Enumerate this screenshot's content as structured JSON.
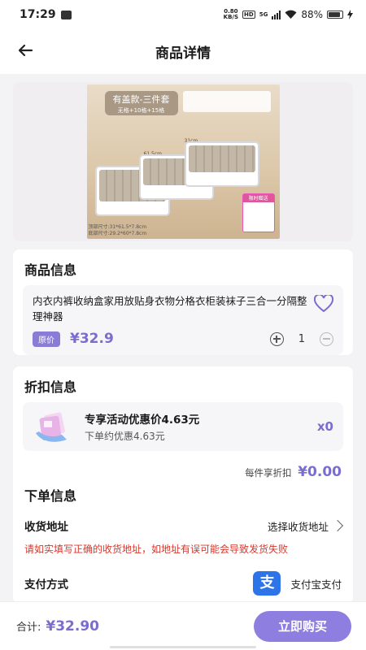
{
  "status_bar": {
    "time": "17:29",
    "speed_value": "0.80",
    "speed_unit": "KB/S",
    "hd": "HD",
    "network": "5G",
    "battery": "88%"
  },
  "header": {
    "title": "商品详情"
  },
  "product_image": {
    "badge_title": "有盖款-三件套",
    "badge_sub": "无格+10格+15格",
    "dim_1": "31cm",
    "dim_2": "61.5cm",
    "size_top": "顶部尺寸:31*61.5*7.8cm",
    "size_bottom": "底部尺寸:29.2*60*7.8cm",
    "gift_label": "限时赠送"
  },
  "product_info": {
    "section_title": "商品信息",
    "name": "内衣内裤收纳盒家用放贴身衣物分格衣柜装袜子三合一分隔整理神器",
    "price_badge": "原价",
    "price": "¥32.9",
    "quantity": "1"
  },
  "discount_info": {
    "section_title": "折扣信息",
    "title": "专享活动优惠价4.63元",
    "subtitle": "下单约优惠4.63元",
    "count": "x0",
    "each_label": "每件享折扣",
    "each_amount": "¥0.00"
  },
  "order_info": {
    "section_title": "下单信息",
    "address_label": "收货地址",
    "address_action": "选择收货地址",
    "warning": "请如实填写正确的收货地址，如地址有误可能会导致发货失败",
    "payment_label": "支付方式",
    "payment_method": "支付宝支付",
    "alipay_glyph": "支"
  },
  "bottom_bar": {
    "total_label": "合计:",
    "total_amount": "¥32.90",
    "buy_label": "立即购买"
  },
  "colors": {
    "accent": "#7a6dd0",
    "button": "#8d7ee0",
    "warning": "#d9362c",
    "alipay": "#2c74e8"
  }
}
